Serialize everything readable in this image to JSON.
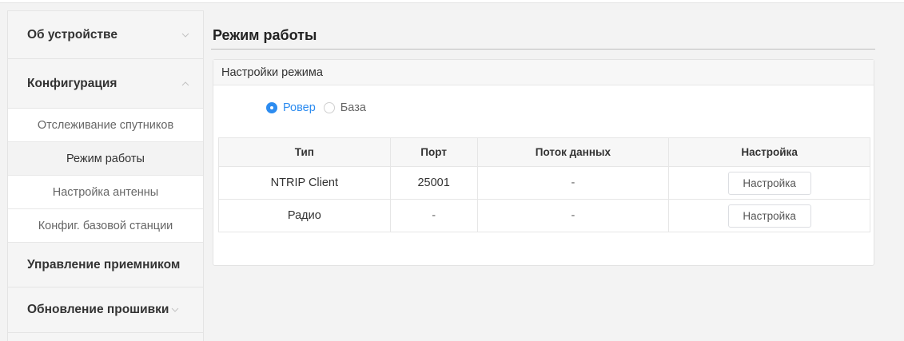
{
  "sidebar": {
    "groups": [
      {
        "label": "Об устройстве",
        "chevron": "chevron-down-icon"
      },
      {
        "label": "Конфигурация",
        "chevron": "chevron-up-icon"
      },
      {
        "label": "Управление приемником"
      },
      {
        "label": "Обновление прошивки",
        "chevron": "chevron-down-icon"
      }
    ],
    "config_items": [
      {
        "label": "Отслеживание спутников",
        "active": false
      },
      {
        "label": "Режим работы",
        "active": true
      },
      {
        "label": "Настройка антенны",
        "active": false
      },
      {
        "label": "Конфиг. базовой станции",
        "active": false
      }
    ]
  },
  "page": {
    "title": "Режим работы"
  },
  "panel": {
    "title": "Настройки режима",
    "modes": [
      {
        "label": "Ровер",
        "checked": true
      },
      {
        "label": "База",
        "checked": false
      }
    ],
    "table": {
      "headers": [
        "Тип",
        "Порт",
        "Поток данных",
        "Настройка"
      ],
      "rows": [
        {
          "type": "NTRIP Client",
          "port": "25001",
          "stream": "-",
          "button": "Настройка"
        },
        {
          "type": "Радио",
          "port": "-",
          "stream": "-",
          "button": "Настройка"
        }
      ]
    }
  },
  "colors": {
    "accent": "#2d8cf0",
    "sidebar_bg": "#f5f5f5",
    "page_bg": "#f3f3f3"
  }
}
